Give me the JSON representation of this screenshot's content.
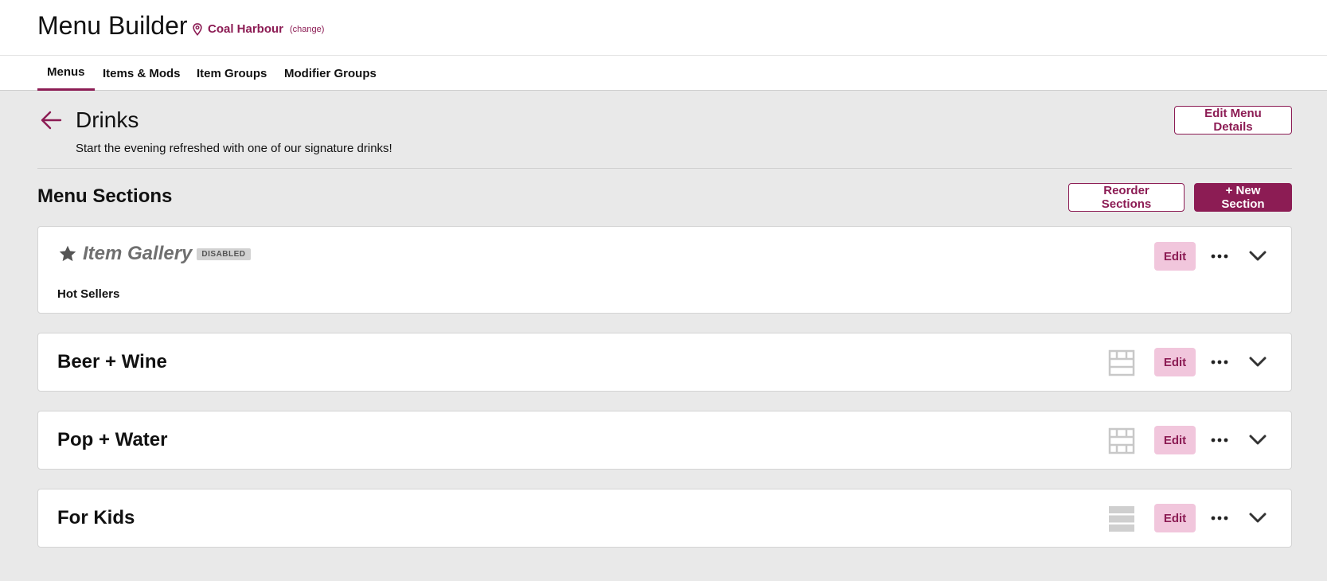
{
  "header": {
    "title": "Menu Builder",
    "location_name": "Coal Harbour",
    "location_change": "(change)"
  },
  "tabs": [
    {
      "label": "Menus",
      "active": true
    },
    {
      "label": "Items & Mods",
      "active": false
    },
    {
      "label": "Item Groups",
      "active": false
    },
    {
      "label": "Modifier Groups",
      "active": false
    }
  ],
  "menu": {
    "title": "Drinks",
    "description": "Start the evening refreshed with one of our signature drinks!",
    "edit_details_label": "Edit Menu Details"
  },
  "sections": {
    "heading": "Menu Sections",
    "reorder_label": "Reorder Sections",
    "new_label": "+ New Section",
    "edit_label": "Edit",
    "gallery": {
      "title": "Item Gallery",
      "badge": "DISABLED",
      "subtitle": "Hot Sellers"
    },
    "items": [
      {
        "title": "Beer + Wine",
        "layout_icon": "grid-layout-icon"
      },
      {
        "title": "Pop + Water",
        "layout_icon": "grid-layout-icon"
      },
      {
        "title": "For Kids",
        "layout_icon": "list-layout-icon"
      }
    ]
  },
  "colors": {
    "brand": "#8c1c54",
    "edit_bg": "#f1c6dc",
    "page_bg": "#e9e9e9"
  }
}
